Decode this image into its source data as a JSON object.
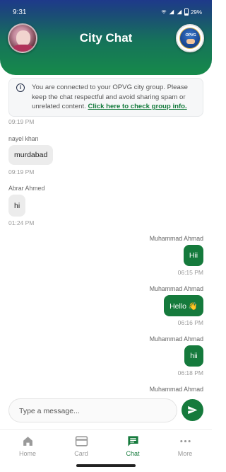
{
  "statusbar": {
    "time": "9:31",
    "battery": "29%"
  },
  "header": {
    "title": "City Chat",
    "group_logo_text": "OPVG"
  },
  "info": {
    "text": "You are connected to your OPVG city group. Please keep the chat respectful and avoid sharing spam or unrelated content.",
    "link": "Click here to check group info."
  },
  "messages": [
    {
      "time": "09:19 PM"
    },
    {
      "sender": "nayel khan",
      "text": "murdabad",
      "time": "09:19 PM"
    },
    {
      "sender": "Abrar Ahmed",
      "text": "hi",
      "time": "01:24 PM"
    },
    {
      "sender": "Muhammad Ahmad",
      "text": "Hii",
      "time": "06:15 PM"
    },
    {
      "sender": "Muhammad Ahmad",
      "text": "Hello 👋",
      "time": "06:16 PM"
    },
    {
      "sender": "Muhammad Ahmad",
      "text": "hii",
      "time": "06:18 PM"
    },
    {
      "sender": "Muhammad Ahmad"
    }
  ],
  "composer": {
    "placeholder": "Type a message..."
  },
  "nav": [
    {
      "label": "Home",
      "icon": "home-icon"
    },
    {
      "label": "Card",
      "icon": "card-icon"
    },
    {
      "label": "Chat",
      "icon": "chat-icon",
      "active": true
    },
    {
      "label": "More",
      "icon": "more-icon"
    }
  ],
  "colors": {
    "accent": "#157a3c",
    "header_top": "#1e3a8a",
    "header_bottom": "#168a4a"
  }
}
